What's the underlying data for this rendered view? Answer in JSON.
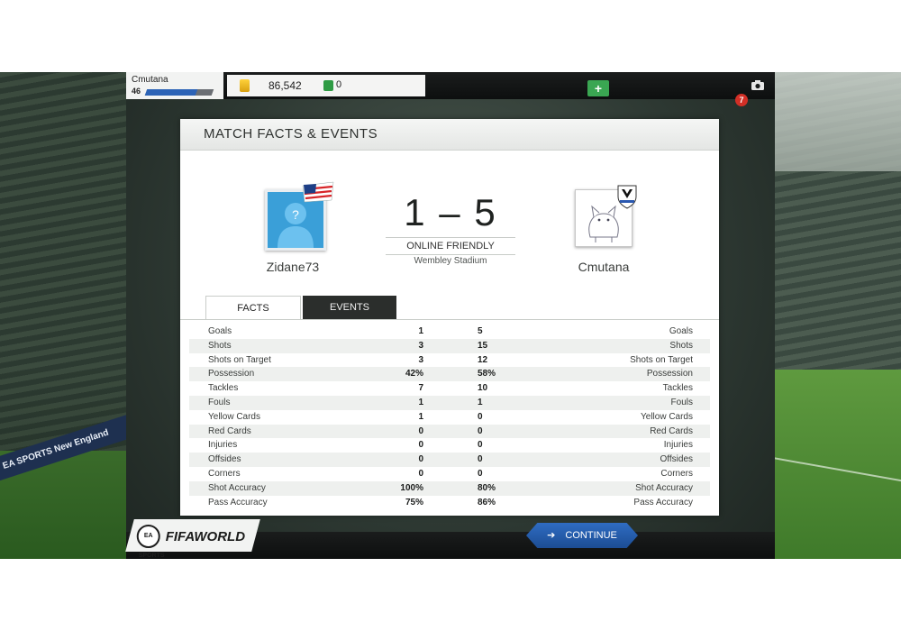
{
  "topbar": {
    "username": "Cmutana",
    "level": "46",
    "xp_progress": 0.76,
    "coins": "86,542",
    "points": "0",
    "add_points_label": "+",
    "notification_count": "7"
  },
  "panel": {
    "title": "MATCH FACTS & EVENTS",
    "home_team": "Zidane73",
    "away_team": "Cmutana",
    "score": "1 – 5",
    "match_type": "ONLINE FRIENDLY",
    "venue": "Wembley Stadium"
  },
  "tabs": {
    "facts": "FACTS",
    "events": "EVENTS"
  },
  "stats": [
    {
      "label": "Goals",
      "home": "1",
      "away": "5"
    },
    {
      "label": "Shots",
      "home": "3",
      "away": "15"
    },
    {
      "label": "Shots on Target",
      "home": "3",
      "away": "12"
    },
    {
      "label": "Possession",
      "home": "42%",
      "away": "58%"
    },
    {
      "label": "Tackles",
      "home": "7",
      "away": "10"
    },
    {
      "label": "Fouls",
      "home": "1",
      "away": "1"
    },
    {
      "label": "Yellow Cards",
      "home": "1",
      "away": "0"
    },
    {
      "label": "Red Cards",
      "home": "0",
      "away": "0"
    },
    {
      "label": "Injuries",
      "home": "0",
      "away": "0"
    },
    {
      "label": "Offsides",
      "home": "0",
      "away": "0"
    },
    {
      "label": "Corners",
      "home": "0",
      "away": "0"
    },
    {
      "label": "Shot Accuracy",
      "home": "100%",
      "away": "80%"
    },
    {
      "label": "Pass Accuracy",
      "home": "75%",
      "away": "86%"
    }
  ],
  "bottombar": {
    "ea_logo_text": "EA SPORTS",
    "brand": "FIFAWORLD",
    "continue_label": "CONTINUE"
  },
  "background": {
    "ad_text": "EA SPORTS  New England"
  },
  "colors": {
    "accent_blue": "#2c63b6",
    "continue_blue": "#2f6cc2",
    "add_green": "#3aa652",
    "notification_red": "#d22f26",
    "home_badge_blue": "#3a9fd8"
  }
}
